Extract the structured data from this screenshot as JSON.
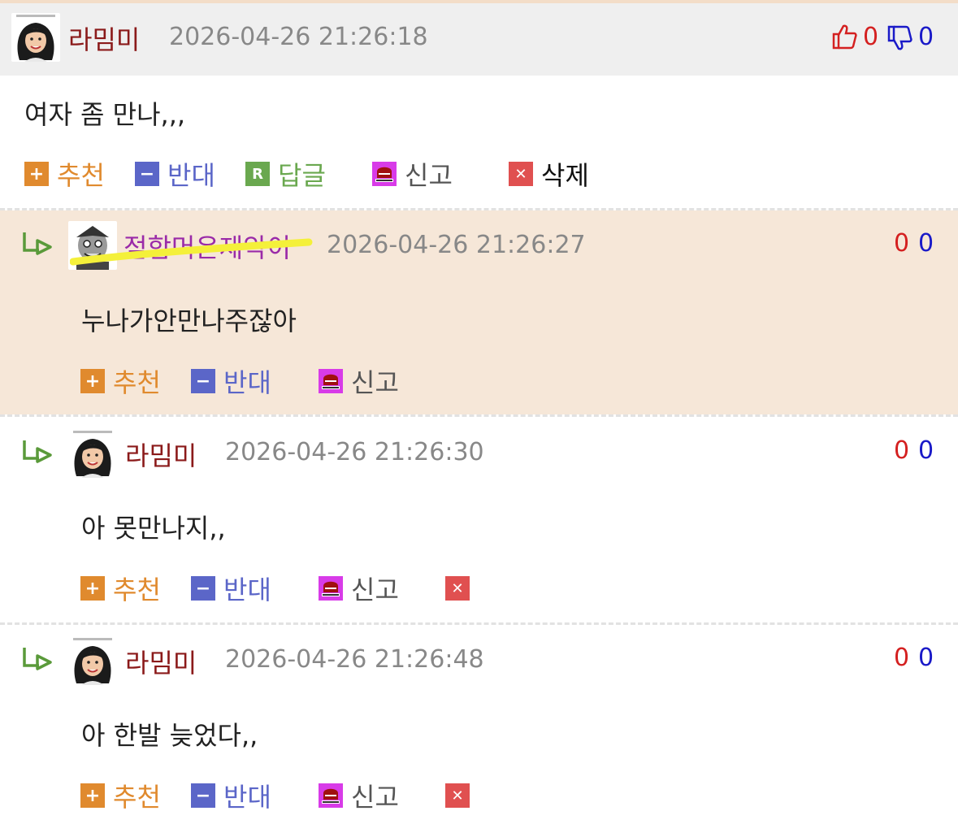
{
  "comments": [
    {
      "nickname": "라밈미",
      "date": "2026-04-26 21:26:18",
      "up": "0",
      "down": "0",
      "text": "여자 좀 만나,,,",
      "actions": {
        "recommend": "추천",
        "oppose": "반대",
        "reply": "답글",
        "report": "신고",
        "delete": "삭제"
      }
    },
    {
      "nickname": "점합머은제악이",
      "date": "2026-04-26 21:26:27",
      "up": "0",
      "down": "0",
      "text": "누나가안만나주잖아",
      "actions": {
        "recommend": "추천",
        "oppose": "반대",
        "report": "신고"
      }
    },
    {
      "nickname": "라밈미",
      "date": "2026-04-26 21:26:30",
      "up": "0",
      "down": "0",
      "text": "아 못만나지,,",
      "actions": {
        "recommend": "추천",
        "oppose": "반대",
        "report": "신고"
      }
    },
    {
      "nickname": "라밈미",
      "date": "2026-04-26 21:26:48",
      "up": "0",
      "down": "0",
      "text": "아 한발 늦었다,,",
      "actions": {
        "recommend": "추천",
        "oppose": "반대",
        "report": "신고"
      }
    }
  ],
  "icons": {
    "recommend": "plus-icon",
    "oppose": "minus-icon",
    "reply": "reply-icon",
    "report": "siren-icon",
    "delete": "close-icon",
    "thumbs_up": "thumbs-up-icon",
    "thumbs_down": "thumbs-down-icon",
    "nested": "reply-arrow-icon"
  },
  "colors": {
    "nickname": "#8b1a1a",
    "recommend": "#e08a2e",
    "oppose": "#5b66c8",
    "reply": "#6aa84f",
    "report": "#d83be8",
    "delete": "#e05050",
    "reply_bg": "#f6e7d8"
  }
}
